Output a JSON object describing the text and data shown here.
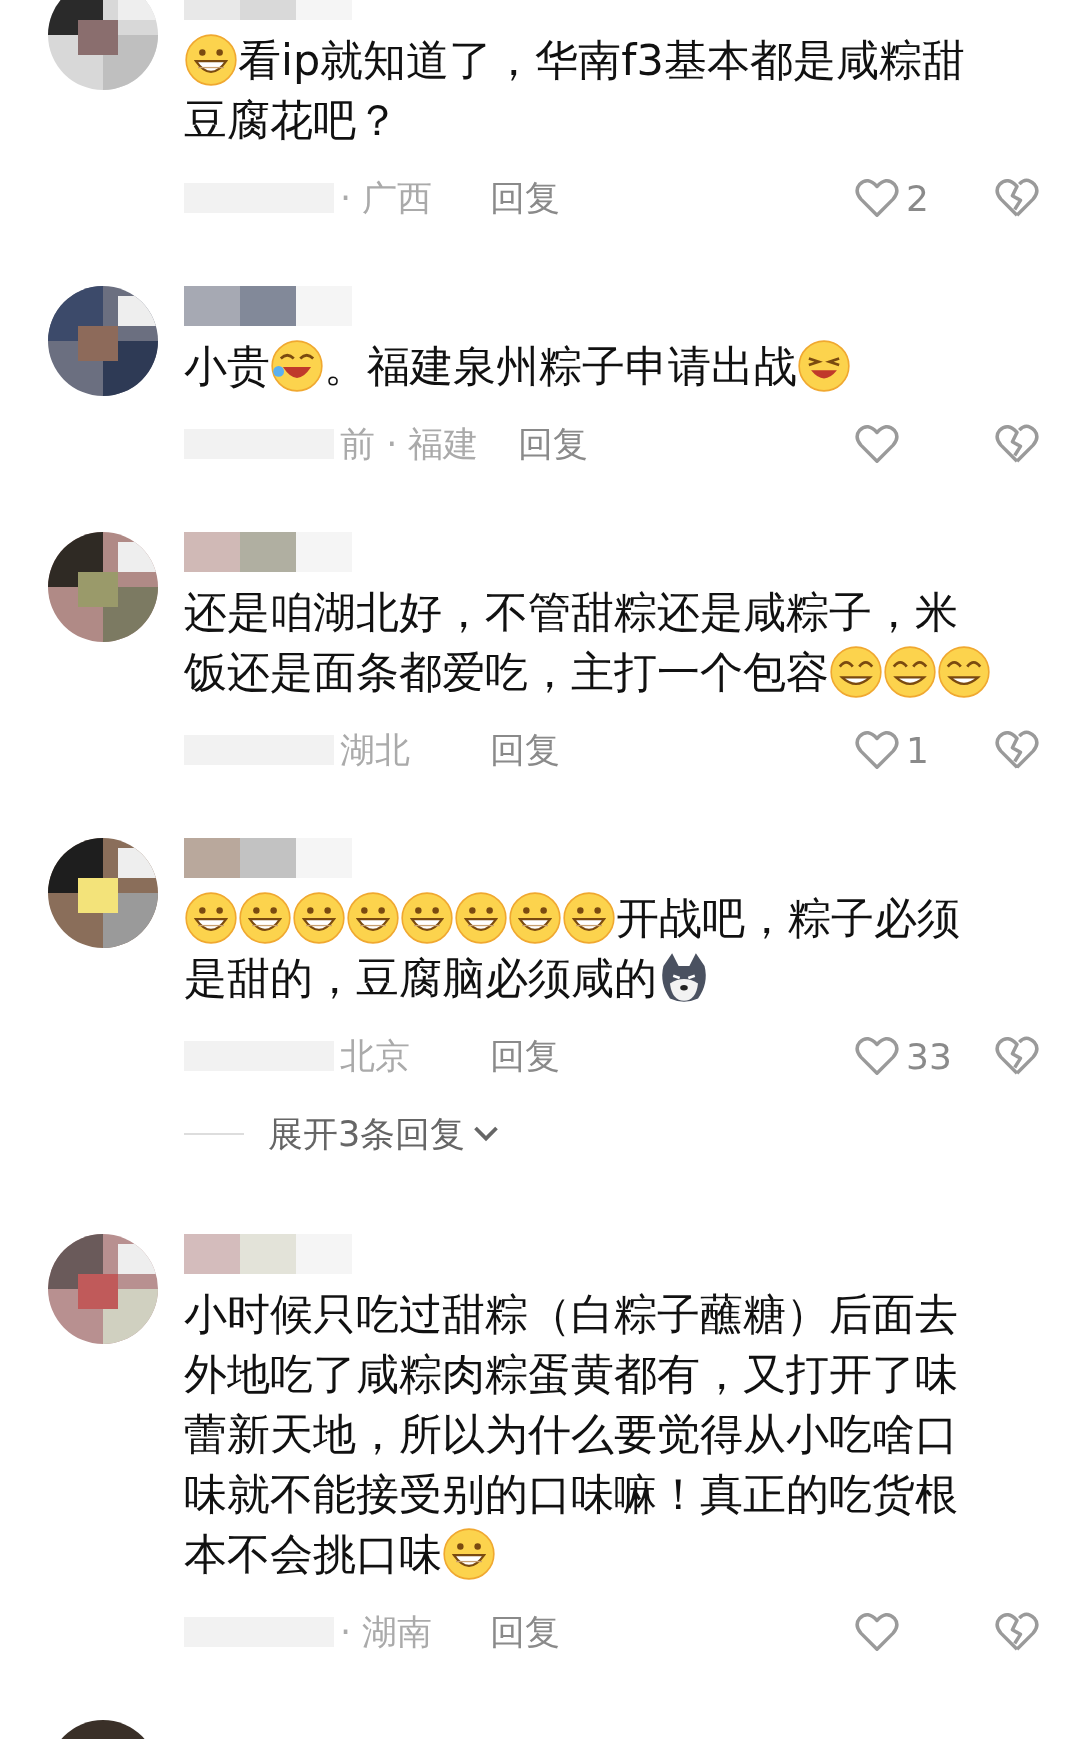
{
  "comments": [
    {
      "lines": [
        [
          {
            "kind": "grin"
          },
          {
            "kind": "text",
            "text": "看ip就知道了，华南f3基本都是咸粽甜"
          }
        ],
        [
          {
            "kind": "text",
            "text": "豆腐花吧？"
          }
        ]
      ],
      "meta": "· 广西",
      "reply": "回复",
      "likes": "2"
    },
    {
      "lines": [
        [
          {
            "kind": "text",
            "text": "小贵"
          },
          {
            "kind": "laugh"
          },
          {
            "kind": "text",
            "text": "。福建泉州粽子申请出战"
          },
          {
            "kind": "wink"
          }
        ]
      ],
      "meta": "前 · 福建",
      "reply": "回复"
    },
    {
      "lines": [
        [
          {
            "kind": "text",
            "text": "还是咱湖北好，不管甜粽还是咸粽子，米"
          }
        ],
        [
          {
            "kind": "text",
            "text": "饭还是面条都爱吃，主打一个包容"
          },
          {
            "kind": "smirk"
          },
          {
            "kind": "smirk"
          },
          {
            "kind": "smirk"
          }
        ]
      ],
      "meta": "湖北",
      "reply": "回复",
      "likes": "1"
    },
    {
      "lines": [
        [
          {
            "kind": "smile"
          },
          {
            "kind": "smile"
          },
          {
            "kind": "smile"
          },
          {
            "kind": "smile"
          },
          {
            "kind": "smile"
          },
          {
            "kind": "smile"
          },
          {
            "kind": "smile"
          },
          {
            "kind": "smile"
          },
          {
            "kind": "text",
            "text": "开战吧，粽子必须"
          }
        ],
        [
          {
            "kind": "text",
            "text": "是甜的，豆腐脑必须咸的"
          },
          {
            "kind": "dog"
          }
        ]
      ],
      "meta": "北京",
      "reply": "回复",
      "likes": "33",
      "expand": "展开3条回复"
    },
    {
      "lines": [
        [
          {
            "kind": "text",
            "text": "小时候只吃过甜粽（白粽子蘸糖）后面去"
          }
        ],
        [
          {
            "kind": "text",
            "text": "外地吃了咸粽肉粽蛋黄都有，又打开了味"
          }
        ],
        [
          {
            "kind": "text",
            "text": "蕾新天地，所以为什么要觉得从小吃啥口"
          }
        ],
        [
          {
            "kind": "text",
            "text": "味就不能接受别的口味嘛！真正的吃货根"
          }
        ],
        [
          {
            "kind": "text",
            "text": "本不会挑口味"
          },
          {
            "kind": "grin"
          }
        ]
      ],
      "meta": "· 湖南",
      "reply": "回复"
    }
  ]
}
